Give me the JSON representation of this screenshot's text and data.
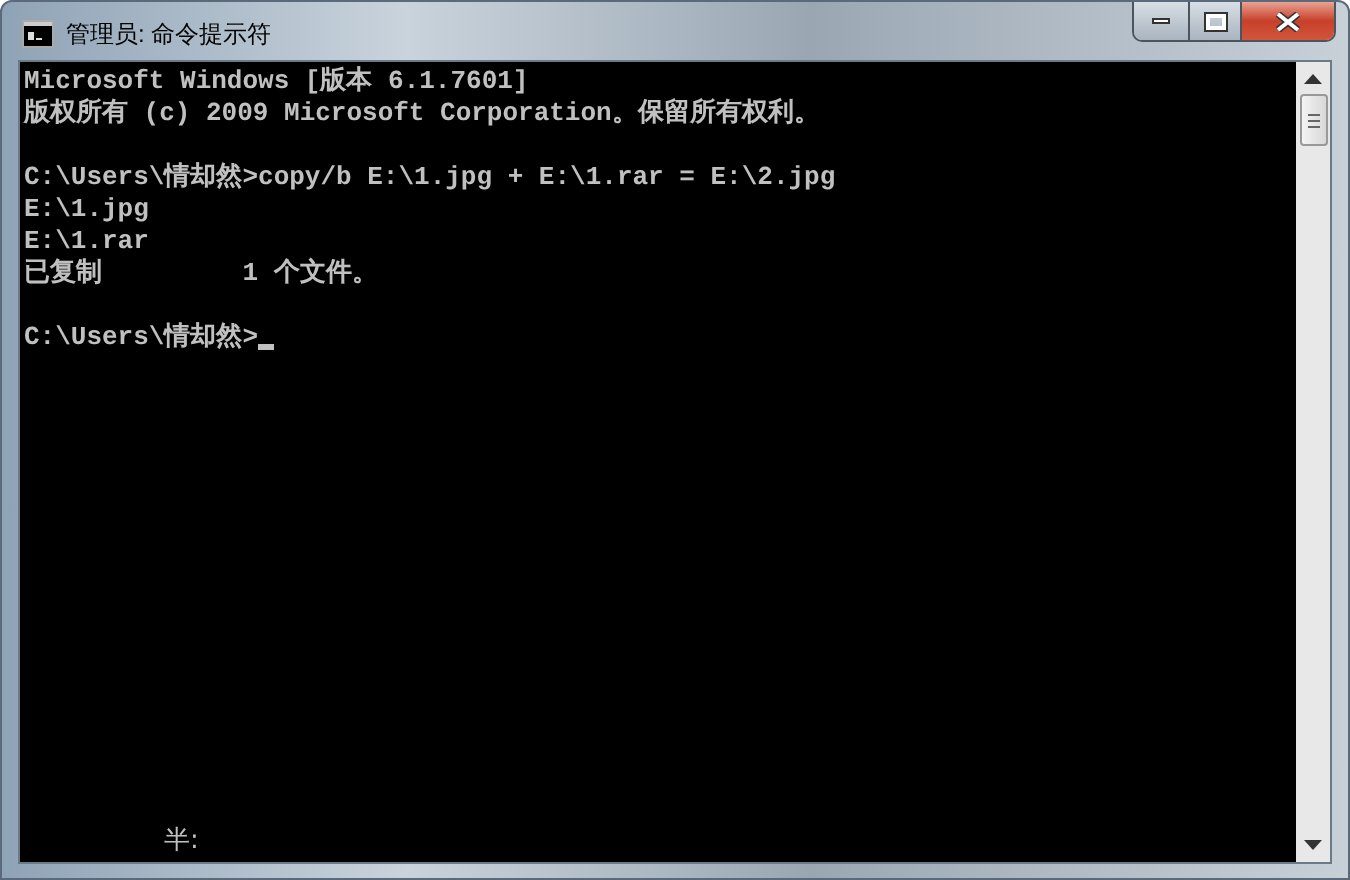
{
  "window": {
    "title": "管理员: 命令提示符"
  },
  "console": {
    "blocks": [
      {
        "lines": [
          "Microsoft Windows [版本 6.1.7601]",
          "版权所有 (c) 2009 Microsoft Corporation。保留所有权利。"
        ]
      },
      {
        "lines": [
          "C:\\Users\\情却然>copy/b E:\\1.jpg + E:\\1.rar = E:\\2.jpg",
          "E:\\1.jpg",
          "E:\\1.rar",
          "已复制         1 个文件。"
        ]
      },
      {
        "lines": [
          "C:\\Users\\情却然>"
        ]
      }
    ],
    "cursor": true
  },
  "ime_status": "半:"
}
